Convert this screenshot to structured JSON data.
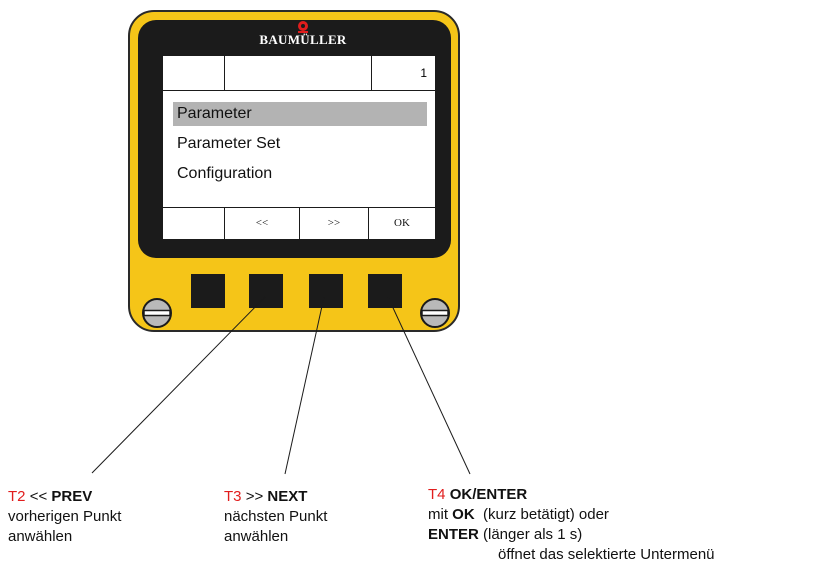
{
  "device": {
    "brand": "BAUMÜLLER",
    "colors": {
      "housing": "#f5c518",
      "bezel": "#1b1b1b",
      "selection": "#b3b3b3",
      "accent_red": "#e11d1d"
    }
  },
  "lcd": {
    "header": {
      "page_number": "1"
    },
    "menu_items": [
      {
        "label": "Parameter",
        "selected": true
      },
      {
        "label": "Parameter Set",
        "selected": false
      },
      {
        "label": "Configuration",
        "selected": false
      }
    ],
    "softkeys": [
      "",
      "<<",
      ">>",
      "OK"
    ]
  },
  "annotations": {
    "t2": {
      "id": "T2",
      "symbol": "<<",
      "name": "PREV",
      "line2": "vorherigen Punkt",
      "line3": "anwählen"
    },
    "t3": {
      "id": "T3",
      "symbol": ">>",
      "name": "NEXT",
      "line2": "nächsten Punkt",
      "line3": "anwählen"
    },
    "t4": {
      "id": "T4",
      "name": "OK/ENTER",
      "line2_prefix": "mit",
      "line2_bold": "OK",
      "line2_suffix": "(kurz betätigt) oder",
      "line3_bold": "ENTER",
      "line3_suffix": "(länger als 1 s)",
      "line4": "öffnet das selektierte Untermenü"
    }
  }
}
